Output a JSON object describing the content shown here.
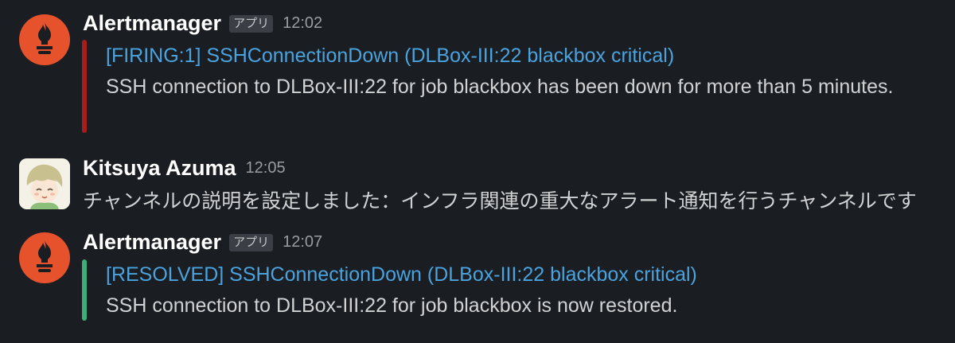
{
  "messages": [
    {
      "sender": "Alertmanager",
      "badge": "アプリ",
      "time": "12:02",
      "avatar_icon": "prometheus-icon",
      "attachment": {
        "color": "#a61d1d",
        "title": "[FIRING:1] SSHConnectionDown (DLBox-III:22 blackbox critical)",
        "text": "SSH connection to DLBox-III:22 for job blackbox has been down for more than 5 minutes."
      }
    },
    {
      "sender": "Kitsuya Azuma",
      "time": "12:05",
      "avatar_icon": "user-avatar",
      "text": "チャンネルの説明を設定しました：インフラ関連の重大なアラート通知を行うチャンネルです"
    },
    {
      "sender": "Alertmanager",
      "badge": "アプリ",
      "time": "12:07",
      "avatar_icon": "prometheus-icon",
      "attachment": {
        "color": "#3dad7a",
        "title": "[RESOLVED] SSHConnectionDown (DLBox-III:22 blackbox critical)",
        "text": "SSH connection to DLBox-III:22 for job blackbox is now restored."
      }
    }
  ],
  "colors": {
    "background": "#1a1d21",
    "link": "#4aa3df",
    "prometheus": "#e6522c"
  }
}
